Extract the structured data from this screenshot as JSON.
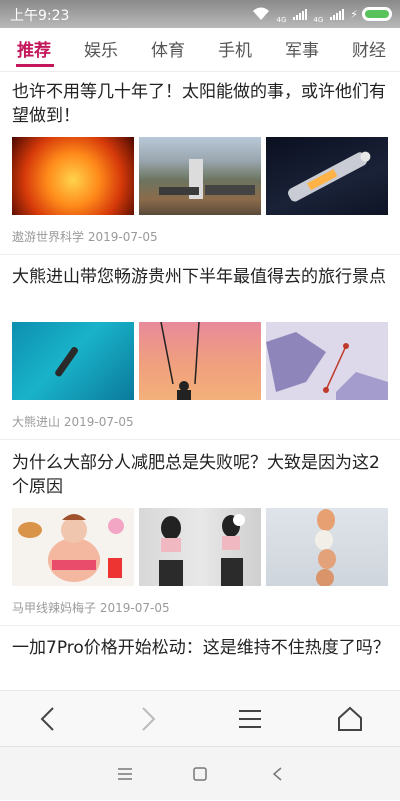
{
  "status_bar": {
    "time": "上午9:23",
    "carrier_tag_1": "4G",
    "carrier_tag_2": "4G",
    "icons": [
      "wifi-icon",
      "signal-icon",
      "signal-icon",
      "charging-icon",
      "battery-icon"
    ],
    "battery_color": "#5ac25a"
  },
  "tabs": [
    {
      "label": "推荐",
      "active": true
    },
    {
      "label": "娱乐",
      "active": false
    },
    {
      "label": "体育",
      "active": false
    },
    {
      "label": "手机",
      "active": false
    },
    {
      "label": "军事",
      "active": false
    },
    {
      "label": "财经",
      "active": false
    }
  ],
  "accent_color": "#c2185b",
  "articles": [
    {
      "title": "也许不用等几十年了！太阳能做的事，或许他们有望做到！",
      "source": "遨游世界科学",
      "date": "2019-07-05",
      "images": [
        "sun-photo",
        "solar-plant-aerial-photo",
        "space-capsule-photo"
      ]
    },
    {
      "title": "大熊进山带您畅游贵州下半年最值得去的旅行景点",
      "source": "大熊进山",
      "date": "2019-07-05",
      "images": [
        "boat-on-turquoise-water-photo",
        "swing-sunset-photo",
        "map-route-photo"
      ]
    },
    {
      "title": "为什么大部分人减肥总是失败呢？大致是因为这2个原因",
      "source": "马甲线辣妈梅子",
      "date": "2019-07-05",
      "images": [
        "cartoon-junk-food-illustration",
        "fitness-women-photo",
        "stacked-eggs-photo"
      ]
    },
    {
      "title": "一加7Pro价格开始松动：这是维持不住热度了吗？"
    }
  ],
  "browser_bar": {
    "icons": [
      "back-arrow-icon",
      "forward-arrow-icon",
      "menu-icon",
      "home-icon"
    ]
  },
  "system_nav": {
    "icons": [
      "recent-apps-icon",
      "home-square-icon",
      "back-triangle-icon"
    ]
  }
}
